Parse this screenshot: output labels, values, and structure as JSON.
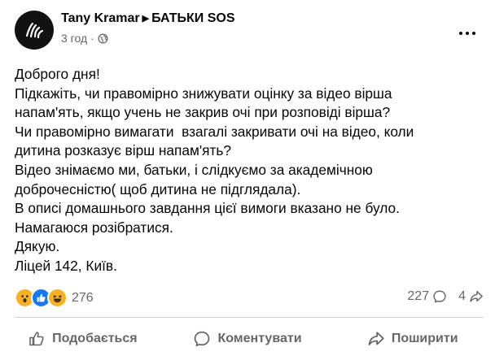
{
  "post": {
    "author": "Tany Kramar",
    "group": "БАТЬКИ SOS",
    "time": "3 год",
    "separator": "·",
    "more_icon": "more-options-icon",
    "globe_icon": "globe-icon",
    "text_lines": [
      "Доброго дня!",
      "Підкажіть, чи правомірно знижувати оцінку за відео вірша",
      "напам'ять, якщо учень не закрив очі при розповіді вірша?",
      "Чи правомірно вимагати  взагалі закривати очі на відео, коли",
      "дитина розказує вірш напам'ять?",
      "Відео знімаємо ми, батьки, і слідкуємо за академічною",
      "доброчесністю( щоб дитина не підглядала).",
      "В описі домашнього завдання цієї вимоги вказано не було.",
      "Намагаюся розібратися.",
      "Дякую.",
      "Ліцей 142, Київ."
    ]
  },
  "engagement": {
    "reactions": [
      "wow",
      "like",
      "haha"
    ],
    "reaction_count": "276",
    "comment_count": "227",
    "share_count": "4"
  },
  "actions": {
    "like_label": "Подобається",
    "comment_label": "Коментувати",
    "share_label": "Поширити"
  },
  "colors": {
    "like_blue": "#1877f2",
    "reaction_yellow": "#f7b125",
    "secondary_text": "#65676b"
  }
}
